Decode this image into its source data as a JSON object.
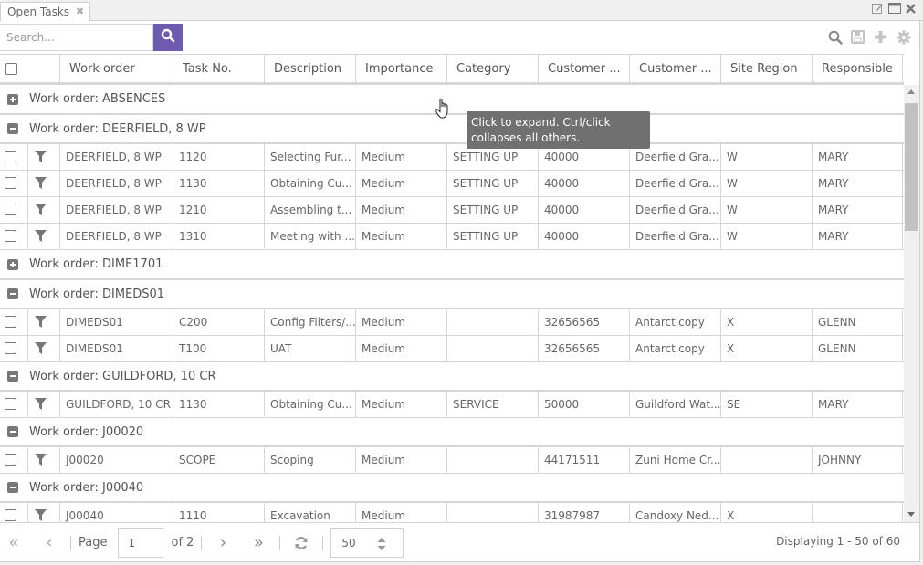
{
  "tab": {
    "title": "Open Tasks",
    "close_icon": "close-icon"
  },
  "window_controls": [
    "edit-icon",
    "maximize-icon",
    "close-icon"
  ],
  "toolbar": {
    "search_placeholder": "Search...",
    "search_value": "",
    "search_button_icon": "search-icon",
    "accent_color": "#6e5bb0",
    "right_icons": [
      "search-icon",
      "save-icon",
      "add-icon",
      "gear-icon"
    ]
  },
  "grid": {
    "columns": [
      "Work order",
      "Task No.",
      "Description",
      "Importance",
      "Category",
      "Customer ...",
      "Customer ...",
      "Site Region",
      "Responsible"
    ],
    "groups": [
      {
        "label": "Work order: ABSENCES",
        "expanded": false,
        "rows": []
      },
      {
        "label": "Work order: DEERFIELD, 8 WP",
        "expanded": true,
        "rows": [
          [
            "DEERFIELD, 8 WP",
            "1120",
            "Selecting Fur...",
            "Medium",
            "SETTING UP",
            "40000",
            "Deerfield Gra...",
            "W",
            "MARY"
          ],
          [
            "DEERFIELD, 8 WP",
            "1130",
            "Obtaining Cu...",
            "Medium",
            "SETTING UP",
            "40000",
            "Deerfield Gra...",
            "W",
            "MARY"
          ],
          [
            "DEERFIELD, 8 WP",
            "1210",
            "Assembling t...",
            "Medium",
            "SETTING UP",
            "40000",
            "Deerfield Gra...",
            "W",
            "MARY"
          ],
          [
            "DEERFIELD, 8 WP",
            "1310",
            "Meeting with ...",
            "Medium",
            "SETTING UP",
            "40000",
            "Deerfield Gra...",
            "W",
            "MARY"
          ]
        ]
      },
      {
        "label": "Work order: DIME1701",
        "expanded": false,
        "rows": []
      },
      {
        "label": "Work order: DIMEDS01",
        "expanded": true,
        "rows": [
          [
            "DIMEDS01",
            "C200",
            "Config Filters/...",
            "Medium",
            "",
            "32656565",
            "Antarcticopy",
            "X",
            "GLENN"
          ],
          [
            "DIMEDS01",
            "T100",
            "UAT",
            "Medium",
            "",
            "32656565",
            "Antarcticopy",
            "X",
            "GLENN"
          ]
        ]
      },
      {
        "label": "Work order: GUILDFORD, 10 CR",
        "expanded": true,
        "rows": [
          [
            "GUILDFORD, 10 CR",
            "1130",
            "Obtaining Cu...",
            "Medium",
            "SERVICE",
            "50000",
            "Guildford Wat...",
            "SE",
            "MARY"
          ]
        ]
      },
      {
        "label": "Work order: J00020",
        "expanded": true,
        "rows": [
          [
            "J00020",
            "SCOPE",
            "Scoping",
            "Medium",
            "",
            "44171511",
            "Zuni Home Cr...",
            "",
            "JOHNNY"
          ]
        ]
      },
      {
        "label": "Work order: J00040",
        "expanded": true,
        "rows": [
          [
            "J00040",
            "1110",
            "Excavation",
            "Medium",
            "",
            "31987987",
            "Candoxy Ned...",
            "X",
            ""
          ]
        ]
      }
    ]
  },
  "tooltip": {
    "text_line1": "Click to expand. Ctrl/click",
    "text_line2": "collapses all others."
  },
  "pager": {
    "page_label": "Page",
    "page_value": "1",
    "of_label": "of 2",
    "page_size": "50",
    "display_info": "Displaying 1 - 50 of 60"
  }
}
